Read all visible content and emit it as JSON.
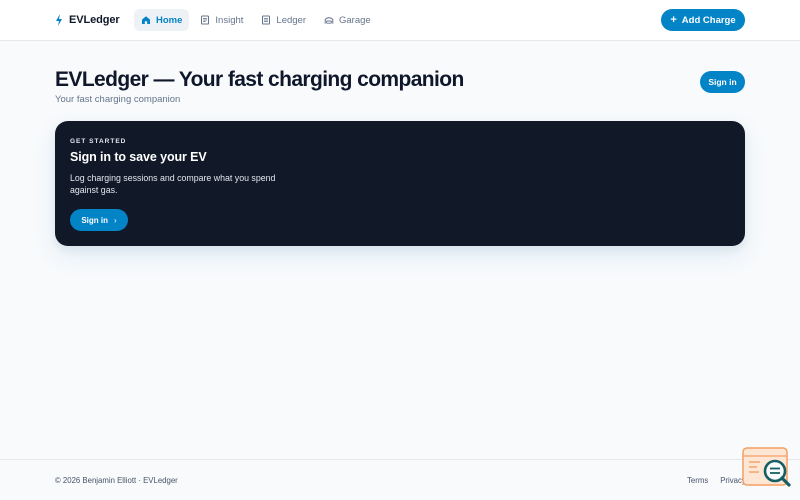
{
  "nav": {
    "brand": "EVLedger",
    "items": [
      {
        "label": "Home",
        "icon": "home-icon",
        "active": true
      },
      {
        "label": "Insight",
        "icon": "insight-icon",
        "active": false
      },
      {
        "label": "Ledger",
        "icon": "ledger-icon",
        "active": false
      },
      {
        "label": "Garage",
        "icon": "garage-icon",
        "active": false
      }
    ],
    "add_label": "Add Charge"
  },
  "header": {
    "title": "EVLedger — Your fast charging companion",
    "subtitle": "Your fast charging companion",
    "signin_label": "Sign in"
  },
  "hero": {
    "eyebrow": "GET STARTED",
    "title": "Sign in to save your EV",
    "body": "Log charging sessions and compare what you spend against gas.",
    "cta_label": "Sign in"
  },
  "footer": {
    "copyright": "© 2026 Benjamin Elliott · EVLedger",
    "links": [
      "Terms",
      "Privacy"
    ]
  },
  "colors": {
    "accent": "#0284c7",
    "hero_bg": "#111827",
    "page_bg": "#f8fafc",
    "widget_orange": "#f59e63",
    "widget_teal": "#155e63"
  }
}
